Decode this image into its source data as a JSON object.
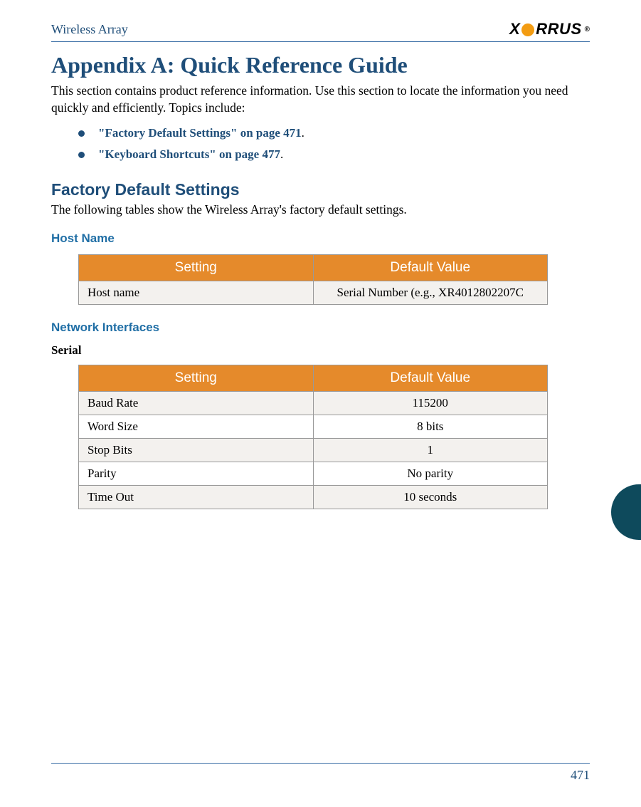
{
  "header": {
    "title": "Wireless Array",
    "logo_text_before": "X",
    "logo_text_after": "RRUS",
    "logo_reg": "®"
  },
  "appendix": {
    "heading": "Appendix A: Quick Reference Guide",
    "intro": "This section contains product reference information. Use this section to locate the information you need quickly and efficiently. Topics include:",
    "topics": [
      "\"Factory Default Settings\" on page 471",
      "\"Keyboard Shortcuts\" on page 477"
    ]
  },
  "factory_defaults": {
    "heading": "Factory Default Settings",
    "desc": "The following tables show the Wireless Array's factory default settings."
  },
  "tables": {
    "column_headers": {
      "setting": "Setting",
      "value": "Default Value"
    },
    "host_name": {
      "heading": "Host Name",
      "rows": [
        {
          "setting": "Host name",
          "value": "Serial Number (e.g., XR4012802207C"
        }
      ]
    },
    "network_interfaces": {
      "heading": "Network Interfaces",
      "serial_heading": "Serial",
      "serial_rows": [
        {
          "setting": "Baud Rate",
          "value": "115200"
        },
        {
          "setting": "Word Size",
          "value": "8 bits"
        },
        {
          "setting": "Stop Bits",
          "value": "1"
        },
        {
          "setting": "Parity",
          "value": "No parity"
        },
        {
          "setting": "Time Out",
          "value": "10 seconds"
        }
      ]
    }
  },
  "footer": {
    "page_number": "471"
  }
}
